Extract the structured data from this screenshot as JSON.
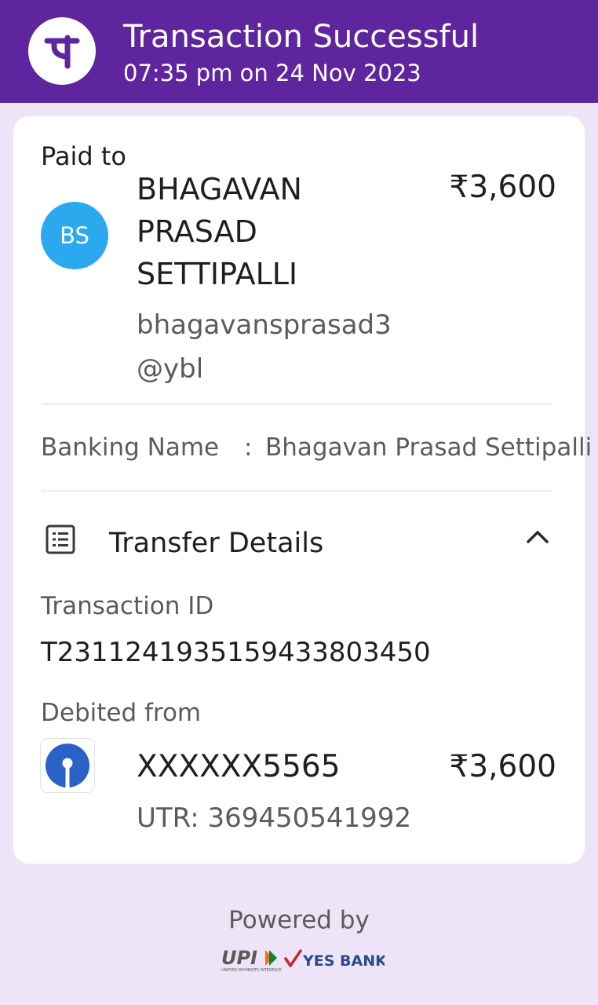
{
  "header": {
    "title": "Transaction Successful",
    "subtitle": "07:35 pm on 24 Nov 2023",
    "logo_icon": "phonepe-logo-icon",
    "background": "#5f259f"
  },
  "payee": {
    "section_label": "Paid to",
    "initials": "BS",
    "name_lines": [
      "BHAGAVAN",
      "PRASAD",
      "SETTIPALLI"
    ],
    "upi_lines": [
      "bhagavansprasad3",
      "@ybl"
    ],
    "amount": "₹3,600",
    "avatar_color": "#2ba9ee"
  },
  "banking": {
    "label": "Banking Name",
    "separator": ":",
    "value": "Bhagavan Prasad Settipalli"
  },
  "transfer": {
    "title": "Transfer Details",
    "icon": "list-icon",
    "toggle_icon": "chevron-up-icon",
    "txn_label": "Transaction ID",
    "txn_id": "T2311241935159433803450",
    "debited_label": "Debited from",
    "bank_icon": "sbi-logo-icon",
    "account": "XXXXXX5565",
    "amount": "₹3,600",
    "utr": "UTR: 369450541992"
  },
  "footer": {
    "powered_by": "Powered by",
    "upi_logo": "UPI",
    "upi_tagline": "UNIFIED PAYMENTS INTERFACE",
    "bank_logo": "YES BANK"
  }
}
